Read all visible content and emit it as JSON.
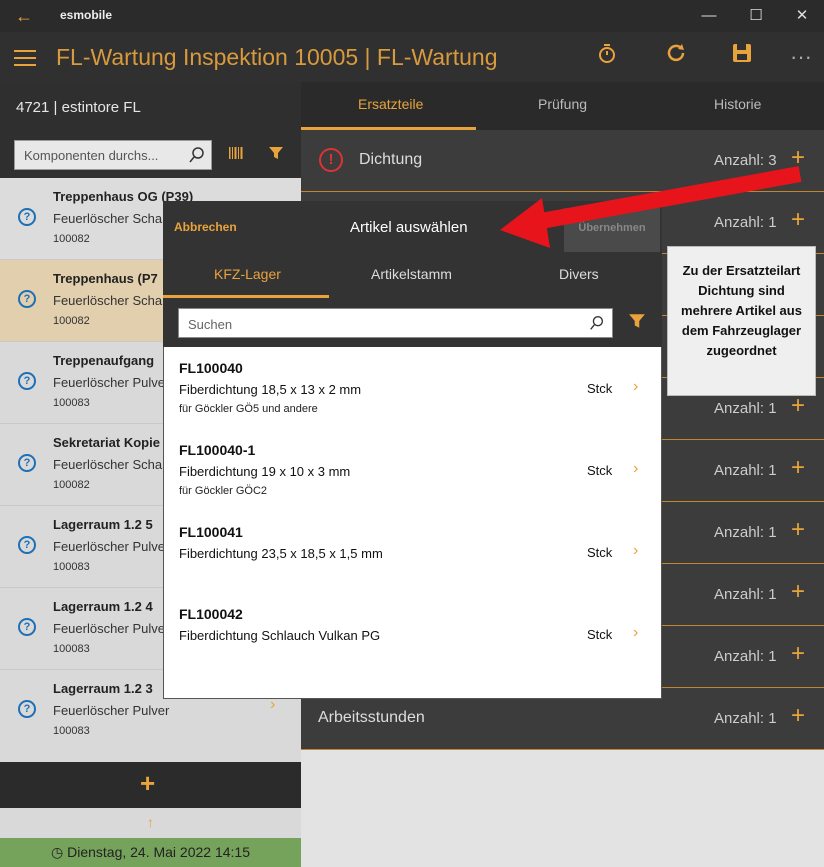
{
  "titlebar": {
    "app_name": "esmobile",
    "back": "←",
    "minimize": "—",
    "maximize": "☐",
    "close": "✕"
  },
  "appbar": {
    "title": "FL-Wartung Inspektion 10005  |  FL-Wartung",
    "more": "···"
  },
  "left": {
    "title": "4721  |  estintore FL",
    "search_placeholder": "Komponenten durchs...",
    "items": [
      {
        "title": "Treppenhaus OG (P39)",
        "sub": "Feuerlöscher Scha",
        "num": "100082"
      },
      {
        "title": "Treppenhaus (P7",
        "sub": "Feuerlöscher Scha",
        "num": "100082"
      },
      {
        "title": "Treppenaufgang",
        "sub": "Feuerlöscher Pulve",
        "num": "100083"
      },
      {
        "title": "Sekretariat Kopie",
        "sub": "Feuerlöscher Scha",
        "num": "100082"
      },
      {
        "title": "Lagerraum 1.2 5",
        "sub": "Feuerlöscher Pulve",
        "num": "100083"
      },
      {
        "title": "Lagerraum 1.2 4",
        "sub": "Feuerlöscher Pulve",
        "num": "100083"
      },
      {
        "title": "Lagerraum 1.2 3",
        "sub": "Feuerlöscher Pulver",
        "num": "100083"
      }
    ],
    "add": "+",
    "up": "↑",
    "date": "Dienstag, 24. Mai 2022 14:15"
  },
  "right": {
    "tabs": [
      "Ersatzteile",
      "Prüfung",
      "Historie"
    ],
    "rows": [
      {
        "label": "Dichtung",
        "count": "Anzahl: 3"
      },
      {
        "label": "",
        "count": "Anzahl: 1"
      },
      {
        "label": "",
        "count": ""
      },
      {
        "label": "",
        "count": ""
      },
      {
        "label": "",
        "count": "Anzahl: 1"
      },
      {
        "label": "",
        "count": "Anzahl: 1"
      },
      {
        "label": "",
        "count": "Anzahl: 1"
      },
      {
        "label": "",
        "count": "Anzahl: 1"
      },
      {
        "label": "",
        "count": "Anzahl: 1"
      },
      {
        "label": "Arbeitsstunden",
        "count": "Anzahl: 1"
      }
    ]
  },
  "modal": {
    "cancel": "Abbrechen",
    "title": "Artikel auswählen",
    "take": "Übernehmen",
    "tabs": [
      "KFZ-Lager",
      "Artikelstamm",
      "Divers"
    ],
    "search_placeholder": "Suchen",
    "articles": [
      {
        "code": "FL100040",
        "name": "Fiberdichtung 18,5 x 13 x 2 mm",
        "sub": "für Göckler GÖ5 und andere",
        "unit": "Stck"
      },
      {
        "code": "FL100040-1",
        "name": "Fiberdichtung 19 x 10 x 3 mm",
        "sub": "für Göckler GÖC2",
        "unit": "Stck"
      },
      {
        "code": "FL100041",
        "name": "Fiberdichtung 23,5 x 18,5 x 1,5 mm",
        "sub": "",
        "unit": "Stck"
      },
      {
        "code": "FL100042",
        "name": "Fiberdichtung Schlauch Vulkan PG",
        "sub": "",
        "unit": "Stck"
      }
    ]
  },
  "callout": "Zu der Ersatzteilart Dichtung sind mehrere Artikel aus dem Fahrzeuglager zugeordnet",
  "colors": {
    "accent": "#e8a33c",
    "warning": "#dd3333",
    "arrow": "#e8141c",
    "status": "#76a35c"
  }
}
